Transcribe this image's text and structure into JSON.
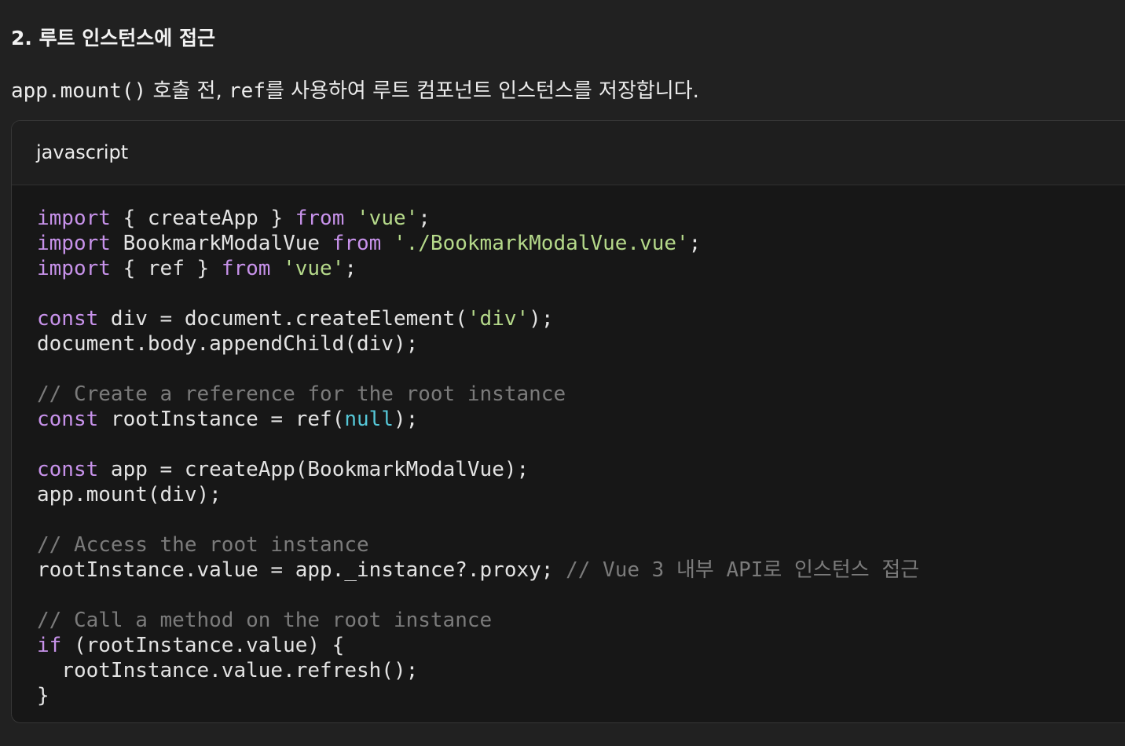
{
  "heading": "2. 루트 인스턴스에 접근",
  "paragraph": {
    "code1": "app.mount()",
    "text1": " 호출 전, ",
    "code2": "ref",
    "text2": "를 사용하여 루트 컴포넌트 인스턴스를 저장합니다."
  },
  "code_block": {
    "language": "javascript",
    "lines": [
      [
        [
          "kw",
          "import"
        ],
        [
          "plain",
          " { createApp } "
        ],
        [
          "kw",
          "from"
        ],
        [
          "plain",
          " "
        ],
        [
          "str",
          "'vue'"
        ],
        [
          "plain",
          ";"
        ]
      ],
      [
        [
          "kw",
          "import"
        ],
        [
          "plain",
          " BookmarkModalVue "
        ],
        [
          "kw",
          "from"
        ],
        [
          "plain",
          " "
        ],
        [
          "str",
          "'./BookmarkModalVue.vue'"
        ],
        [
          "plain",
          ";"
        ]
      ],
      [
        [
          "kw",
          "import"
        ],
        [
          "plain",
          " { ref } "
        ],
        [
          "kw",
          "from"
        ],
        [
          "plain",
          " "
        ],
        [
          "str",
          "'vue'"
        ],
        [
          "plain",
          ";"
        ]
      ],
      [],
      [
        [
          "kw",
          "const"
        ],
        [
          "plain",
          " div = document.createElement("
        ],
        [
          "str",
          "'div'"
        ],
        [
          "plain",
          ");"
        ]
      ],
      [
        [
          "plain",
          "document.body.appendChild(div);"
        ]
      ],
      [],
      [
        [
          "com",
          "// Create a reference for the root instance"
        ]
      ],
      [
        [
          "kw",
          "const"
        ],
        [
          "plain",
          " rootInstance = ref("
        ],
        [
          "lit",
          "null"
        ],
        [
          "plain",
          ");"
        ]
      ],
      [],
      [
        [
          "kw",
          "const"
        ],
        [
          "plain",
          " app = createApp(BookmarkModalVue);"
        ]
      ],
      [
        [
          "plain",
          "app.mount(div);"
        ]
      ],
      [],
      [
        [
          "com",
          "// Access the root instance"
        ]
      ],
      [
        [
          "plain",
          "rootInstance.value = app._instance?.proxy; "
        ],
        [
          "com",
          "// Vue 3 내부 API로 인스턴스 접근"
        ]
      ],
      [],
      [
        [
          "com",
          "// Call a method on the root instance"
        ]
      ],
      [
        [
          "kw",
          "if"
        ],
        [
          "plain",
          " (rootInstance.value) {"
        ]
      ],
      [
        [
          "plain",
          "  rootInstance.value.refresh();"
        ]
      ],
      [
        [
          "plain",
          "}"
        ]
      ]
    ]
  }
}
